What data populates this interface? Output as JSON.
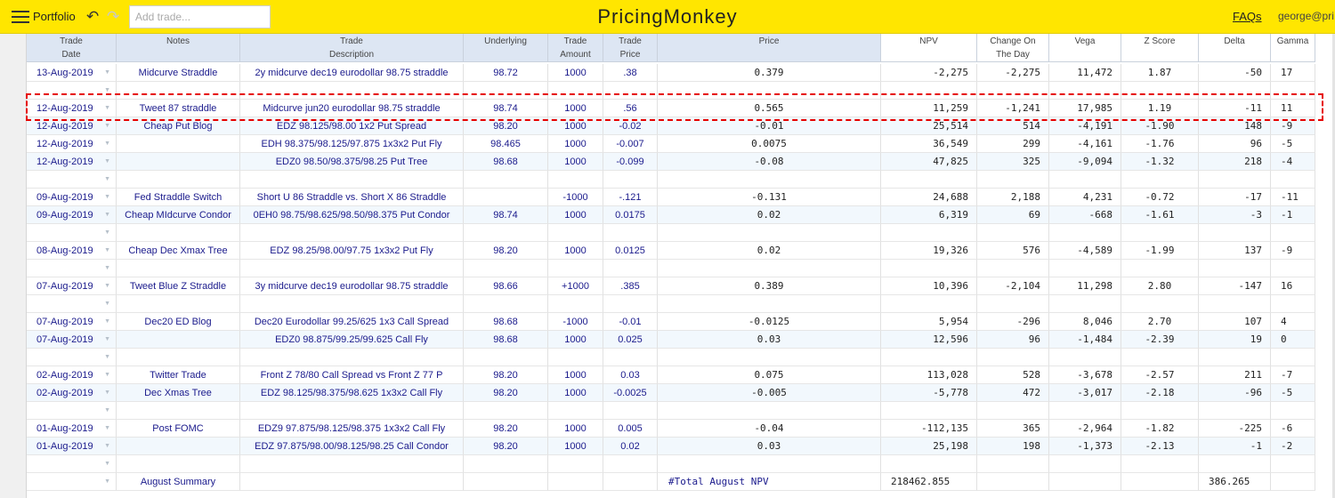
{
  "topbar": {
    "portfolio_label": "Portfolio",
    "add_trade_placeholder": "Add trade...",
    "brand": "PricingMonkey",
    "faqs": "FAQs",
    "user": "george@pri"
  },
  "columns": [
    {
      "key": "date",
      "label": "Trade\nDate"
    },
    {
      "key": "notes",
      "label": "Notes"
    },
    {
      "key": "desc",
      "label": "Trade\nDescription"
    },
    {
      "key": "und",
      "label": "Underlying"
    },
    {
      "key": "amt",
      "label": "Trade\nAmount"
    },
    {
      "key": "tp",
      "label": "Trade\nPrice"
    },
    {
      "key": "price",
      "label": "Price"
    },
    {
      "key": "npv",
      "label": "NPV"
    },
    {
      "key": "chg",
      "label": "Change On\nThe Day"
    },
    {
      "key": "vega",
      "label": "Vega"
    },
    {
      "key": "z",
      "label": "Z Score"
    },
    {
      "key": "delta",
      "label": "Delta"
    },
    {
      "key": "gamma",
      "label": "Gamma"
    }
  ],
  "rows": [
    {
      "type": "trade",
      "date": "13-Aug-2019",
      "notes": "Midcurve Straddle",
      "desc": "2y midcurve dec19 eurodollar 98.75 straddle",
      "und": "98.72",
      "amt": "1000",
      "tp": ".38",
      "price": "0.379",
      "npv": "-2,275",
      "chg": "-2,275",
      "vega": "11,472",
      "z": "1.87",
      "delta": "-50",
      "gamma": "17"
    },
    {
      "type": "empty"
    },
    {
      "type": "trade",
      "date": "12-Aug-2019",
      "notes": "Tweet 87 straddle",
      "desc": "Midcurve jun20 eurodollar 98.75 straddle",
      "und": "98.74",
      "amt": "1000",
      "tp": ".56",
      "price": "0.565",
      "npv": "11,259",
      "chg": "-1,241",
      "vega": "17,985",
      "z": "1.19",
      "delta": "-11",
      "gamma": "11"
    },
    {
      "type": "trade",
      "date": "12-Aug-2019",
      "notes": "Cheap Put Blog",
      "desc": "EDZ 98.125/98.00 1x2 Put Spread",
      "und": "98.20",
      "amt": "1000",
      "tp": "-0.02",
      "price": "-0.01",
      "npv": "25,514",
      "chg": "514",
      "vega": "-4,191",
      "z": "-1.90",
      "delta": "148",
      "gamma": "-9"
    },
    {
      "type": "trade",
      "date": "12-Aug-2019",
      "notes": "",
      "desc": "EDH 98.375/98.125/97.875 1x3x2 Put Fly",
      "und": "98.465",
      "amt": "1000",
      "tp": "-0.007",
      "price": "0.0075",
      "npv": "36,549",
      "chg": "299",
      "vega": "-4,161",
      "z": "-1.76",
      "delta": "96",
      "gamma": "-5"
    },
    {
      "type": "trade",
      "date": "12-Aug-2019",
      "notes": "",
      "desc": "EDZ0 98.50/98.375/98.25 Put Tree",
      "und": "98.68",
      "amt": "1000",
      "tp": "-0.099",
      "price": "-0.08",
      "npv": "47,825",
      "chg": "325",
      "vega": "-9,094",
      "z": "-1.32",
      "delta": "218",
      "gamma": "-4"
    },
    {
      "type": "empty"
    },
    {
      "type": "trade",
      "date": "09-Aug-2019",
      "notes": "Fed Straddle Switch",
      "desc": "Short U 86 Straddle vs. Short X 86 Straddle",
      "und": "",
      "amt": "-1000",
      "tp": "-.121",
      "price": "-0.131",
      "npv": "24,688",
      "chg": "2,188",
      "vega": "4,231",
      "z": "-0.72",
      "delta": "-17",
      "gamma": "-11"
    },
    {
      "type": "trade",
      "date": "09-Aug-2019",
      "notes": "Cheap MIdcurve Condor",
      "desc": "0EH0 98.75/98.625/98.50/98.375 Put Condor",
      "und": "98.74",
      "amt": "1000",
      "tp": "0.0175",
      "price": "0.02",
      "npv": "6,319",
      "chg": "69",
      "vega": "-668",
      "z": "-1.61",
      "delta": "-3",
      "gamma": "-1"
    },
    {
      "type": "empty"
    },
    {
      "type": "trade",
      "date": "08-Aug-2019",
      "notes": "Cheap Dec Xmax Tree",
      "desc": "EDZ 98.25/98.00/97.75 1x3x2 Put Fly",
      "und": "98.20",
      "amt": "1000",
      "tp": "0.0125",
      "price": "0.02",
      "npv": "19,326",
      "chg": "576",
      "vega": "-4,589",
      "z": "-1.99",
      "delta": "137",
      "gamma": "-9"
    },
    {
      "type": "empty"
    },
    {
      "type": "trade",
      "date": "07-Aug-2019",
      "notes": "Tweet Blue Z Straddle",
      "desc": "3y midcurve dec19 eurodollar 98.75 straddle",
      "und": "98.66",
      "amt": "+1000",
      "tp": ".385",
      "price": "0.389",
      "npv": "10,396",
      "chg": "-2,104",
      "vega": "11,298",
      "z": "2.80",
      "delta": "-147",
      "gamma": "16"
    },
    {
      "type": "empty"
    },
    {
      "type": "trade",
      "date": "07-Aug-2019",
      "notes": "Dec20 ED Blog",
      "desc": "Dec20 Eurodollar 99.25/625 1x3 Call Spread",
      "und": "98.68",
      "amt": "-1000",
      "tp": "-0.01",
      "price": "-0.0125",
      "npv": "5,954",
      "chg": "-296",
      "vega": "8,046",
      "z": "2.70",
      "delta": "107",
      "gamma": "4"
    },
    {
      "type": "trade",
      "date": "07-Aug-2019",
      "notes": "",
      "desc": "EDZ0 98.875/99.25/99.625 Call Fly",
      "und": "98.68",
      "amt": "1000",
      "tp": "0.025",
      "price": "0.03",
      "npv": "12,596",
      "chg": "96",
      "vega": "-1,484",
      "z": "-2.39",
      "delta": "19",
      "gamma": "0"
    },
    {
      "type": "empty"
    },
    {
      "type": "trade",
      "date": "02-Aug-2019",
      "notes": "Twitter Trade",
      "desc": "Front Z 78/80 Call Spread vs Front Z 77 P",
      "und": "98.20",
      "amt": "1000",
      "tp": "0.03",
      "price": "0.075",
      "npv": "113,028",
      "chg": "528",
      "vega": "-3,678",
      "z": "-2.57",
      "delta": "211",
      "gamma": "-7"
    },
    {
      "type": "trade",
      "date": "02-Aug-2019",
      "notes": "Dec Xmas Tree",
      "desc": "EDZ 98.125/98.375/98.625 1x3x2 Call Fly",
      "und": "98.20",
      "amt": "1000",
      "tp": "-0.0025",
      "price": "-0.005",
      "npv": "-5,778",
      "chg": "472",
      "vega": "-3,017",
      "z": "-2.18",
      "delta": "-96",
      "gamma": "-5"
    },
    {
      "type": "empty"
    },
    {
      "type": "trade",
      "date": "01-Aug-2019",
      "notes": "Post FOMC",
      "desc": "EDZ9 97.875/98.125/98.375 1x3x2 Call Fly",
      "und": "98.20",
      "amt": "1000",
      "tp": "0.005",
      "price": "-0.04",
      "npv": "-112,135",
      "chg": "365",
      "vega": "-2,964",
      "z": "-1.82",
      "delta": "-225",
      "gamma": "-6"
    },
    {
      "type": "trade",
      "date": "01-Aug-2019",
      "notes": "",
      "desc": "EDZ 97.875/98.00/98.125/98.25 Call Condor",
      "und": "98.20",
      "amt": "1000",
      "tp": "0.02",
      "price": "0.03",
      "npv": "25,198",
      "chg": "198",
      "vega": "-1,373",
      "z": "-2.13",
      "delta": "-1",
      "gamma": "-2"
    },
    {
      "type": "empty"
    },
    {
      "type": "summary",
      "date": "",
      "notes": "August Summary",
      "desc": "",
      "und": "",
      "amt": "",
      "tp": "",
      "price": "#Total August NPV",
      "npv": "218462.855",
      "chg": "",
      "vega": "",
      "z": "",
      "delta": "386.265",
      "gamma": ""
    }
  ],
  "colors": {
    "topbar": "#ffe600",
    "header_blue": "#dde6f3",
    "row_alt": "#f2f8fd",
    "text_blue": "#1a1a8c",
    "highlight": "#e60000"
  },
  "icons": {
    "menu": "hamburger-icon",
    "undo": "undo-icon",
    "redo": "redo-icon",
    "dropdown": "dropdown-arrow-icon"
  }
}
